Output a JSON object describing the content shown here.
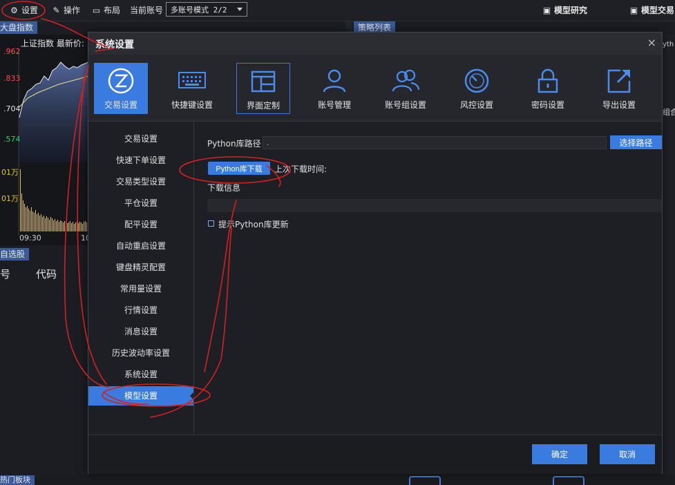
{
  "toolbar": {
    "settings": "设置",
    "operate": "操作",
    "layout": "布局",
    "current_account_label": "当前账号",
    "account_mode": "多账号模式 2/2",
    "model_research": "模型研究",
    "model_trading": "模型交易"
  },
  "background": {
    "index_tab": "大盘指数",
    "strategy_tab": "策略列表",
    "chart_header": "上证指数  最新价:",
    "prices": [
      ".962",
      ".833",
      ".704",
      ".574"
    ],
    "volumes": [
      "01万",
      "01万"
    ],
    "time_tick": "09:30",
    "time_tick2": "10",
    "watchlist_tab": "自选股",
    "watchlist_col_no": "号",
    "watchlist_col_code": "代码",
    "hot_sector": "热门板块",
    "right_snippet_1": "yth",
    "right_snippet_2": "组合"
  },
  "dialog": {
    "title": "系统设置",
    "close": "×",
    "icon_tabs": [
      {
        "label": "交易设置",
        "icon": "trade-icon"
      },
      {
        "label": "快捷键设置",
        "icon": "keyboard-icon"
      },
      {
        "label": "界面定制",
        "icon": "layout-icon"
      },
      {
        "label": "账号管理",
        "icon": "user-icon"
      },
      {
        "label": "账号组设置",
        "icon": "user-group-icon"
      },
      {
        "label": "风控设置",
        "icon": "gauge-icon"
      },
      {
        "label": "密码设置",
        "icon": "lock-icon"
      },
      {
        "label": "导出设置",
        "icon": "export-icon"
      }
    ],
    "nav": [
      "交易设置",
      "快速下单设置",
      "交易类型设置",
      "平仓设置",
      "配平设置",
      "自动重启设置",
      "键盘精灵配置",
      "常用量设置",
      "行情设置",
      "消息设置",
      "历史波动率设置",
      "系统设置",
      "模型设置"
    ],
    "active_nav_index": 12,
    "content": {
      "python_path_label": "Python库路径",
      "python_path_value": ".",
      "choose_path_button": "选择路径",
      "download_button": "Python库下载",
      "last_download_label": "上次下载时间:",
      "download_info_label": "下载信息",
      "prompt_update_label": "提示Python库更新",
      "prompt_update_checked": false
    },
    "ok_button": "确定",
    "cancel_button": "取消"
  },
  "colors": {
    "accent": "#3a7be0",
    "annotation": "#d42020",
    "price_red": "#ff4a4a",
    "price_green": "#29d36c",
    "volume_yellow": "#e6c81e"
  }
}
